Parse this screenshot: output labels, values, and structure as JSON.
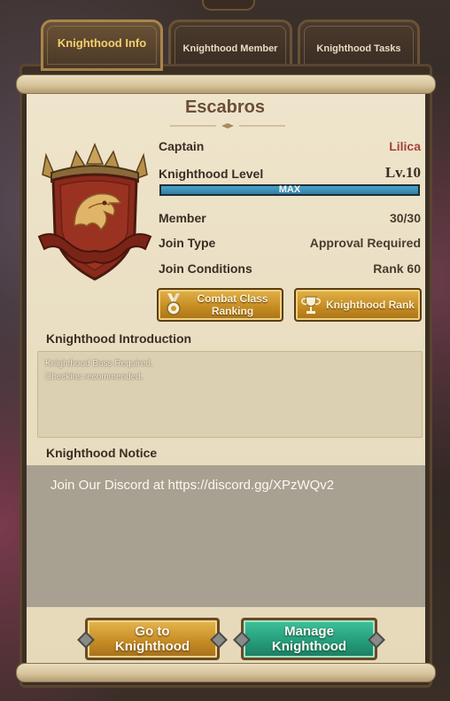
{
  "tabs": [
    {
      "label": "Knighthood Info",
      "active": true
    },
    {
      "label": "Knighthood Member",
      "active": false
    },
    {
      "label": "Knighthood Tasks",
      "active": false
    }
  ],
  "knighthood": {
    "name": "Escabros",
    "captain_label": "Captain",
    "captain_value": "Lilica",
    "level_label": "Knighthood Level",
    "level_value": "Lv.10",
    "level_progress_text": "MAX",
    "level_progress": 1.0,
    "member_label": "Member",
    "member_value": "30/30",
    "join_type_label": "Join Type",
    "join_type_value": "Approval Required",
    "join_conditions_label": "Join Conditions",
    "join_conditions_value": "Rank 60"
  },
  "buttons": {
    "combat_ranking": "Combat Class Ranking",
    "knighthood_rank": "Knighthood Rank",
    "go_to": "Go to Knighthood",
    "manage": "Manage Knighthood"
  },
  "introduction": {
    "title": "Knighthood Introduction",
    "line1": "Knighthood Boss Required.",
    "line2": "Checkins recommended."
  },
  "notice": {
    "title": "Knighthood Notice",
    "text": "Join Our Discord at https://discord.gg/XPzWQv2"
  },
  "colors": {
    "gold": "#c48a20",
    "green": "#249a78",
    "captain_red": "#a4443a",
    "progress_blue": "#2f7fa4"
  },
  "icons": [
    "eagle-crest-icon",
    "medal-icon",
    "trophy-icon"
  ]
}
